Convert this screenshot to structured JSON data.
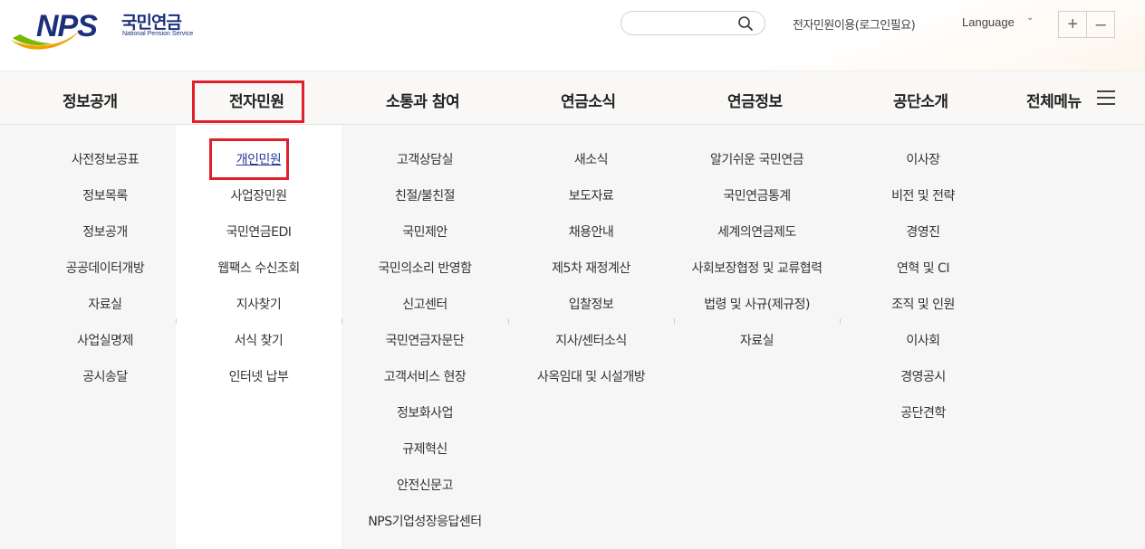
{
  "header": {
    "logo_en": "NPS",
    "logo_ko": "국민연금",
    "logo_sub": "National Pension Service",
    "search_placeholder": "",
    "login_link": "전자민원이용(로그인필요)",
    "language": "Language",
    "zoom_in": "+",
    "zoom_out": "–"
  },
  "colors": {
    "brand": "#1b2f7a",
    "accent_green": "#7ab800",
    "accent_orange": "#f2a100",
    "highlight": "#e0202a"
  },
  "nav": {
    "items": [
      "정보공개",
      "전자민원",
      "소통과 참여",
      "연금소식",
      "연금정보",
      "공단소개"
    ],
    "all_menu": "전체메뉴",
    "active_index": 1
  },
  "menus": [
    [
      "사전정보공표",
      "정보목록",
      "정보공개",
      "공공데이터개방",
      "자료실",
      "사업실명제",
      "공시송달"
    ],
    [
      "개인민원",
      "사업장민원",
      "국민연금EDI",
      "웹팩스 수신조회",
      "지사찾기",
      "서식 찾기",
      "인터넷 납부"
    ],
    [
      "고객상담실",
      "친절/불친절",
      "국민제안",
      "국민의소리 반영함",
      "신고센터",
      "국민연금자문단",
      "고객서비스 현장",
      "정보화사업",
      "규제혁신",
      "안전신문고",
      "NPS기업성장응답센터"
    ],
    [
      "새소식",
      "보도자료",
      "채용안내",
      "제5차 재정계산",
      "입찰정보",
      "지사/센터소식",
      "사옥임대 및 시설개방"
    ],
    [
      "알기쉬운 국민연금",
      "국민연금통계",
      "세계의연금제도",
      "사회보장협정 및 교류협력",
      "법령 및 사규(제규정)",
      "자료실"
    ],
    [
      "이사장",
      "비전 및 전략",
      "경영진",
      "연혁 및 CI",
      "조직 및 인원",
      "이사회",
      "경영공시",
      "공단견학"
    ]
  ],
  "current_submenu": {
    "column": 1,
    "item": 0
  }
}
